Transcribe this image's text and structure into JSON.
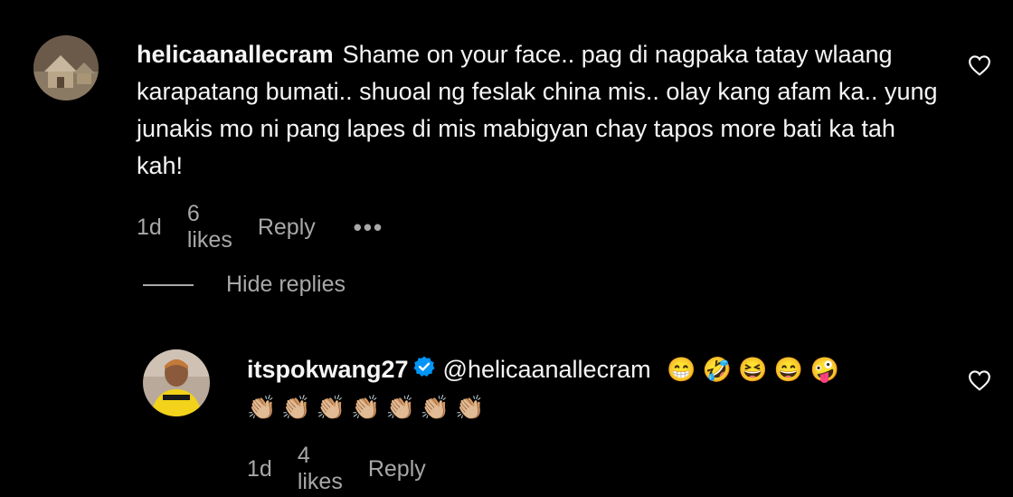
{
  "comment": {
    "username": "helicaanallecram",
    "text": "Shame on your face.. pag di nagpaka tatay wlaang karapatang bumati.. shuoal ng feslak china mis.. olay kang afam ka.. yung junakis mo ni pang lapes di mis mabigyan chay tapos more bati ka tah kah!",
    "time": "1d",
    "likes": "6 likes",
    "reply_label": "Reply",
    "more_label": "•••"
  },
  "hide_replies_label": "Hide replies",
  "reply": {
    "username": "itspokwang27",
    "mention": "@helicaanallecram",
    "emojis_line1": "😁 🤣 😆 😄 🤪",
    "emojis_line2": "👏🏼👏🏼👏🏼👏🏼👏🏼👏🏼👏🏼",
    "time": "1d",
    "likes": "4 likes",
    "reply_label": "Reply"
  },
  "colors": {
    "background": "#000000",
    "text": "#f5f5f5",
    "muted": "#a8a8a8",
    "verified": "#0095f6"
  }
}
